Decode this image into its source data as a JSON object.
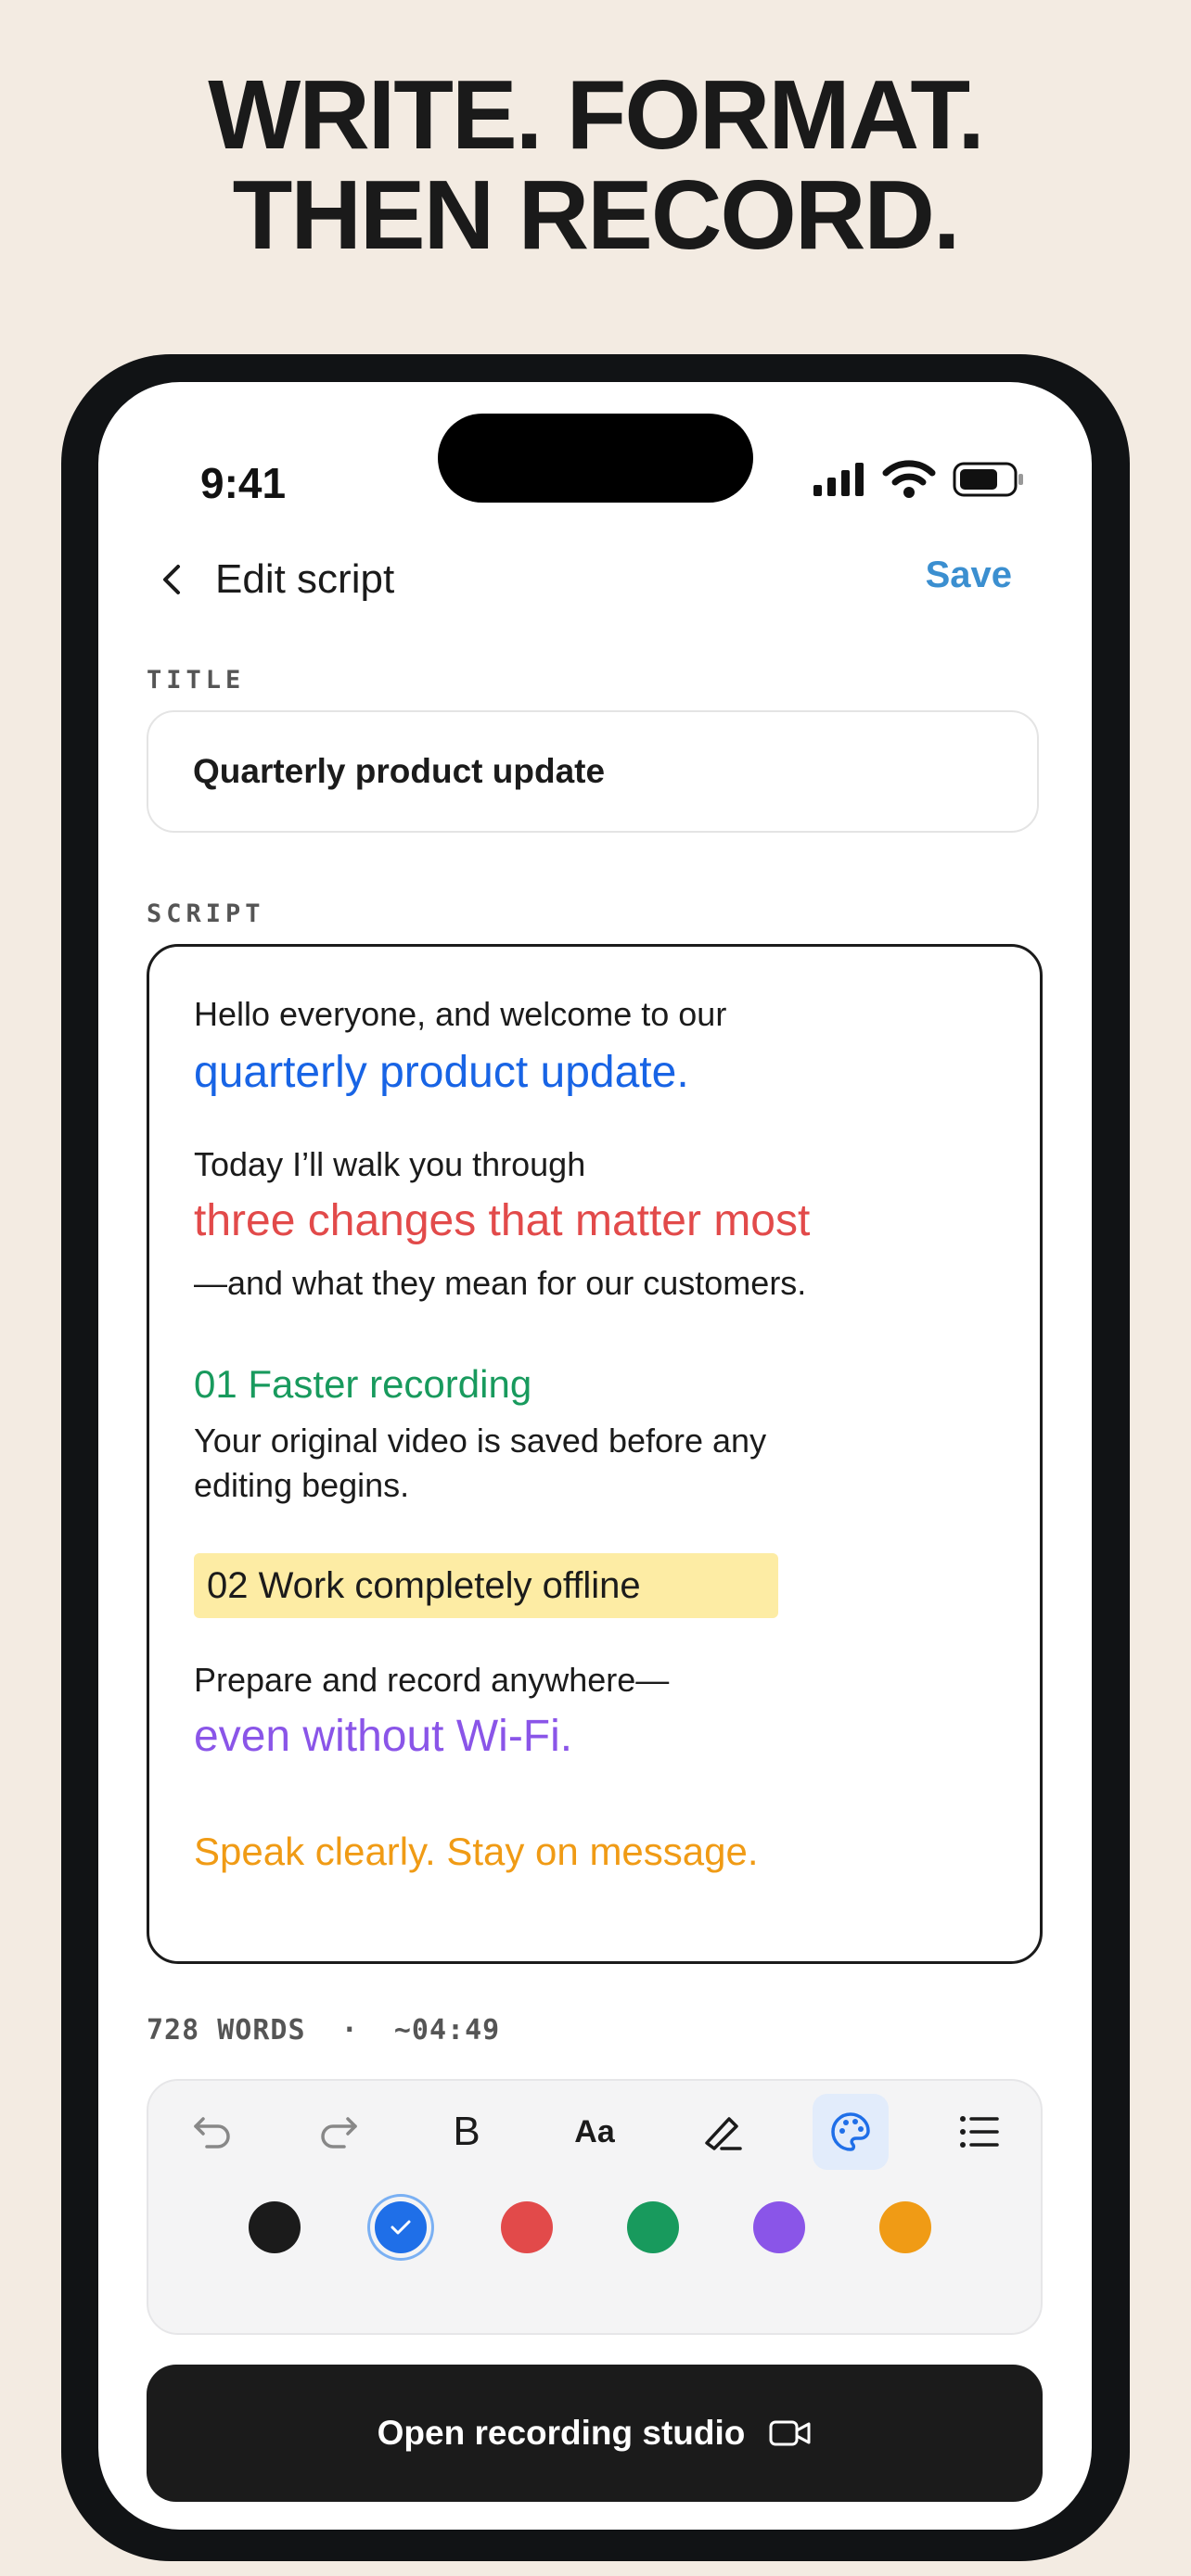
{
  "headline": {
    "line1": "WRITE. FORMAT.",
    "line2": "THEN RECORD."
  },
  "status_bar": {
    "time": "9:41"
  },
  "nav": {
    "title": "Edit script",
    "save_label": "Save"
  },
  "title_section": {
    "label": "TITLE",
    "value": "Quarterly product update"
  },
  "script_section": {
    "label": "SCRIPT",
    "lines": {
      "l1": "Hello everyone, and welcome to our",
      "l2": "quarterly product update.",
      "l3": "Today I’ll walk you through",
      "l4": "three changes that matter most",
      "l5": "—and what they mean for our customers.",
      "l6": "01  Faster recording",
      "l7": "Your original video is saved before any",
      "l8": "editing begins.",
      "l9": "02  Work completely offline",
      "l10": "Prepare and record anywhere—",
      "l11": "even without Wi-Fi.",
      "l12": "Speak clearly. Stay on message."
    }
  },
  "stats": {
    "words": "728 WORDS",
    "separator": "·",
    "duration": "~04:49"
  },
  "toolbar": {
    "tools": [
      "undo-icon",
      "redo-icon",
      "bold-icon",
      "font-size-icon",
      "highlighter-icon",
      "palette-icon",
      "list-icon"
    ],
    "bold_glyph": "B",
    "font_glyph": "Aa",
    "active_tool": "palette-icon",
    "colors": [
      "#1b1b1b",
      "#1f6fe8",
      "#e24a4a",
      "#189a5d",
      "#8a55e8",
      "#f09b15"
    ],
    "selected_color": "#1f6fe8"
  },
  "cta": {
    "label": "Open recording studio",
    "icon": "video-camera-icon"
  }
}
